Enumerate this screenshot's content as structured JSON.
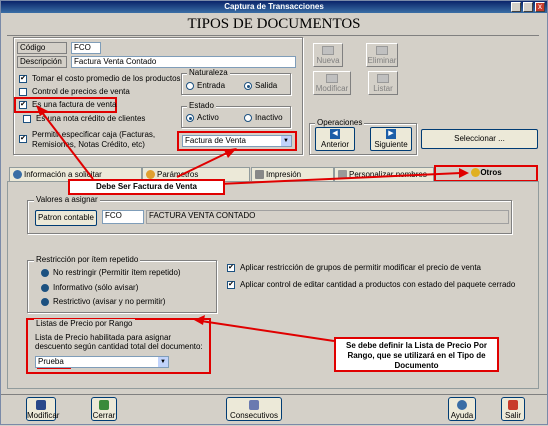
{
  "window": {
    "title": "Captura de Transacciones"
  },
  "heading": "TIPOS DE DOCUMENTOS",
  "form": {
    "codigo_label": "Código",
    "codigo_value": "FCO",
    "descripcion_label": "Descripción",
    "descripcion_value": "Factura Venta Contado",
    "cb_costo": "Tomar el costo promedio de los productos",
    "cb_control_precios": "Control de precios de venta",
    "cb_factura_venta": "Es una factura de venta",
    "cb_nota_credito": "Es una nota crédito de clientes",
    "cb_permitir_caja": "Permitir especificar caja (Facturas, Remisiones, Notas Crédito, etc)",
    "naturaleza": {
      "title": "Naturaleza",
      "entrada": "Entrada",
      "salida": "Salida"
    },
    "estado": {
      "title": "Estado",
      "activo": "Activo",
      "inactivo": "Inactivo"
    },
    "doc_select": "Factura de Venta"
  },
  "toolbar": {
    "nueva": "Nueva",
    "eliminar": "Eliminar",
    "modificar": "Modificar",
    "listar": "Listar"
  },
  "operaciones": {
    "title": "Operaciones",
    "anterior": "Anterior",
    "siguiente": "Siguiente",
    "seleccionar": "Seleccionar ..."
  },
  "tabs": [
    {
      "label": "Información a solicitar"
    },
    {
      "label": "Parámetros"
    },
    {
      "label": "Impresión"
    },
    {
      "label": "Personalizar nombres"
    },
    {
      "label": "Otros"
    }
  ],
  "annotation_factura": "Debe Ser Factura de Venta",
  "valores": {
    "title": "Valores a asignar",
    "patron_label": "Patron contable",
    "patron_code": "FCO",
    "patron_desc": "FACTURA VENTA CONTADO"
  },
  "restriccion": {
    "title": "Restricción por ítem repetido",
    "opt1": "No restringir (Permitir ítem repetido)",
    "opt2": "Informativo (sólo avisar)",
    "opt3": "Restrictivo (avisar y no permitir)"
  },
  "cb_restriccion_grupos": "Aplicar restricción de grupos de permitir modificar el precio de venta",
  "cb_control_editar": "Aplicar control de editar cantidad a productos con estado del paquete cerrado",
  "listas": {
    "title": "Listas de Precio por Rango",
    "desc": "Lista de Precio habilitada para asignar descuento según cantidad total del documento:",
    "select": "Prueba"
  },
  "annotation_lista": "Se debe definir la Lista de Precio Por Rango, que se utilizará en el Tipo de Documento",
  "bottom": {
    "modificar": "Modificar",
    "cerrar": "Cerrar",
    "consecutivos": "Consecutivos",
    "ayuda": "Ayuda",
    "salir": "Salir"
  },
  "colors": {
    "annotation": "#e00000",
    "title_bar": "#0a246a"
  }
}
